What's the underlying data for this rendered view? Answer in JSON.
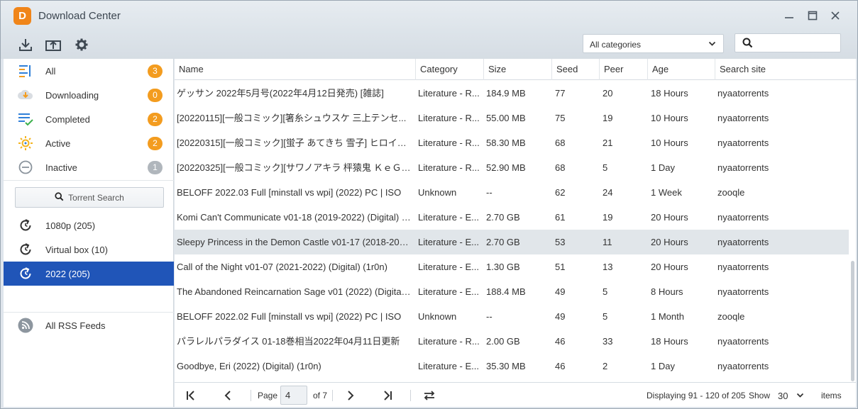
{
  "window": {
    "title": "Download Center",
    "logo_letter": "D",
    "accent": "#f08519"
  },
  "toolbar": {
    "category_select": "All categories"
  },
  "sidebar": {
    "filters": [
      {
        "label": "All",
        "count": "3",
        "icon": "all-list-icon",
        "badge_color": "#f39c1f"
      },
      {
        "label": "Downloading",
        "count": "0",
        "icon": "downloading-icon",
        "badge_color": "#f39c1f"
      },
      {
        "label": "Completed",
        "count": "2",
        "icon": "completed-icon",
        "badge_color": "#f39c1f"
      },
      {
        "label": "Active",
        "count": "2",
        "icon": "active-sun-icon",
        "badge_color": "#f39c1f"
      },
      {
        "label": "Inactive",
        "count": "1",
        "icon": "inactive-icon",
        "badge_color": "#b0b6bc"
      }
    ],
    "torrent_search_label": "Torrent Search",
    "searches": [
      {
        "label": "1080p (205)"
      },
      {
        "label": "Virtual box (10)"
      },
      {
        "label": "2022 (205)",
        "selected": true
      }
    ],
    "rss_label": "All RSS Feeds",
    "selected_color": "#2055b8"
  },
  "table": {
    "columns": [
      "Name",
      "Category",
      "Size",
      "Seed",
      "Peer",
      "Age",
      "Search site"
    ],
    "rows": [
      {
        "name": "ゲッサン 2022年5月号(2022年4月12日発売) [雑誌]",
        "category": "Literature - R...",
        "size": "184.9 MB",
        "seed": "77",
        "peer": "20",
        "age": "18 Hours",
        "site": "nyaatorrents"
      },
      {
        "name": "[20220115][一般コミック][箸糸シュウスケ 三上テンセ...",
        "category": "Literature - R...",
        "size": "55.00 MB",
        "seed": "75",
        "peer": "19",
        "age": "10 Hours",
        "site": "nyaatorrents"
      },
      {
        "name": "[20220315][一般コミック][蛍子 あてきち 雪子] ヒロイン...",
        "category": "Literature - R...",
        "size": "58.30 MB",
        "seed": "68",
        "peer": "21",
        "age": "10 Hours",
        "site": "nyaatorrents"
      },
      {
        "name": "[20220325][一般コミック][サワノアキラ 枰猿鬼 ＫｅＧ] ...",
        "category": "Literature - R...",
        "size": "52.90 MB",
        "seed": "68",
        "peer": "5",
        "age": "1 Day",
        "site": "nyaatorrents"
      },
      {
        "name": "BELOFF 2022.03 Full [minstall vs wpi] (2022) PC | ISO",
        "category": "Unknown",
        "size": "--",
        "seed": "62",
        "peer": "24",
        "age": "1 Week",
        "site": "zooqle"
      },
      {
        "name": "Komi Can't Communicate v01-18 (2019-2022) (Digital) (1...",
        "category": "Literature - E...",
        "size": "2.70 GB",
        "seed": "61",
        "peer": "19",
        "age": "20 Hours",
        "site": "nyaatorrents"
      },
      {
        "name": "Sleepy Princess in the Demon Castle v01-17 (2018-2022)...",
        "category": "Literature - E...",
        "size": "2.70 GB",
        "seed": "53",
        "peer": "11",
        "age": "20 Hours",
        "site": "nyaatorrents",
        "selected": true
      },
      {
        "name": "Call of the Night v01-07 (2021-2022) (Digital) (1r0n)",
        "category": "Literature - E...",
        "size": "1.30 GB",
        "seed": "51",
        "peer": "13",
        "age": "20 Hours",
        "site": "nyaatorrents"
      },
      {
        "name": "The Abandoned Reincarnation Sage v01 (2022) (Digital) (...",
        "category": "Literature - E...",
        "size": "188.4 MB",
        "seed": "49",
        "peer": "5",
        "age": "8 Hours",
        "site": "nyaatorrents"
      },
      {
        "name": "BELOFF 2022.02 Full [minstall vs wpi] (2022) PC | ISO",
        "category": "Unknown",
        "size": "--",
        "seed": "49",
        "peer": "5",
        "age": "1 Month",
        "site": "zooqle"
      },
      {
        "name": "パラレルパラダイス 01-18巻相当2022年04月11日更新",
        "category": "Literature - R...",
        "size": "2.00 GB",
        "seed": "46",
        "peer": "33",
        "age": "18 Hours",
        "site": "nyaatorrents"
      },
      {
        "name": "Goodbye, Eri (2022) (Digital) (1r0n)",
        "category": "Literature - E...",
        "size": "35.30 MB",
        "seed": "46",
        "peer": "2",
        "age": "1 Day",
        "site": "nyaatorrents"
      }
    ]
  },
  "pager": {
    "page_label": "Page",
    "page_value": "4",
    "of_label": "of 7",
    "displaying": "Displaying 91 - 120 of 205",
    "show_label": "Show",
    "per_page": "30",
    "items_label": "items"
  }
}
